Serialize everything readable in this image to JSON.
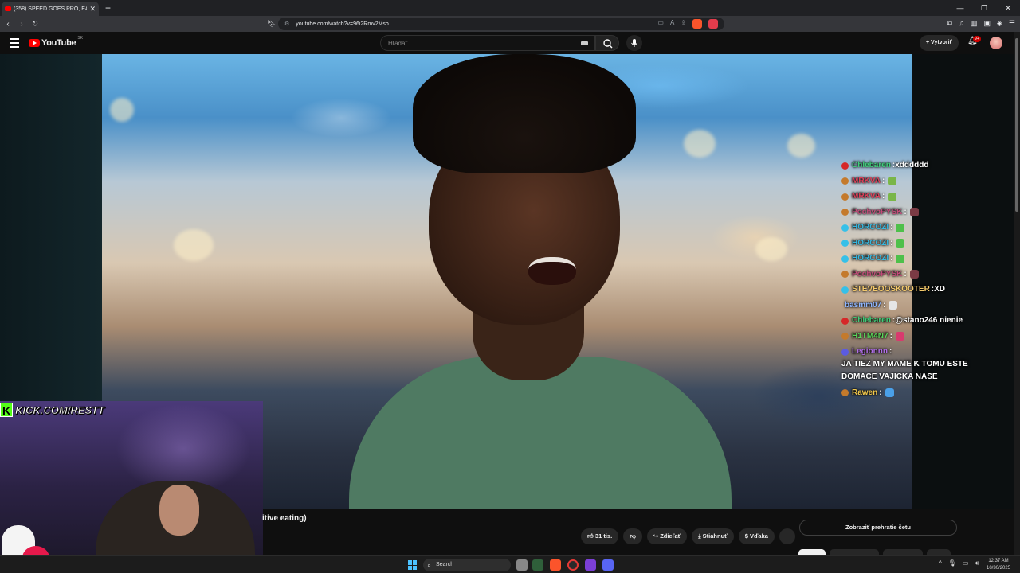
{
  "browser": {
    "tab_title": "(358) SPEED GOES PRO, EATS",
    "url": "youtube.com/watch?v=96i2Rmv2Mso",
    "notification_count": "1"
  },
  "youtube": {
    "logo_text": "YouTube",
    "country_code": "SK",
    "search_placeholder": "Hľadať",
    "create_label": "Vytvoriť",
    "notification_badge": "9+"
  },
  "overlay": {
    "kick_label": "KICK.COM/RESTT",
    "kick_letter": "K"
  },
  "chat": [
    {
      "user": "Chlebaren",
      "msg": "xdddddd",
      "color": "#3fd07a",
      "badge": "#d62828",
      "emote": null
    },
    {
      "user": "MRKVA",
      "msg": "",
      "color": "#e0405a",
      "badge": "#c47a2c",
      "emote": "#7ab648"
    },
    {
      "user": "MRKVA",
      "msg": "",
      "color": "#e0405a",
      "badge": "#c47a2c",
      "emote": "#7ab648"
    },
    {
      "user": "PochvoPYSK",
      "msg": "",
      "color": "#c34c7a",
      "badge": "#c47a2c",
      "emote": "#7a3a44"
    },
    {
      "user": "HORCOZI",
      "msg": "",
      "color": "#35b8e0",
      "badge": "#36c0e8",
      "emote": "#4ec04a"
    },
    {
      "user": "HORCOZI",
      "msg": "",
      "color": "#35b8e0",
      "badge": "#36c0e8",
      "emote": "#4ec04a"
    },
    {
      "user": "HORCOZI",
      "msg": "",
      "color": "#35b8e0",
      "badge": "#36c0e8",
      "emote": "#4ec04a"
    },
    {
      "user": "PochvoPYSK",
      "msg": "",
      "color": "#c34c7a",
      "badge": "#c47a2c",
      "emote": "#7a3a44"
    },
    {
      "user": "STEVEOOSKOOTER",
      "msg": "XD",
      "color": "#f3c96b",
      "badge": "#36c0e8",
      "emote": null
    },
    {
      "user": "basmm07",
      "msg": "",
      "color": "#8fb6ff",
      "badge": null,
      "emote": "#e6e6e6"
    },
    {
      "user": "Chlebaren",
      "msg": "@stano246 nienie",
      "color": "#3fd07a",
      "badge": "#d62828",
      "emote": null
    },
    {
      "user": "H1TM4N7",
      "msg": "",
      "color": "#5ad65a",
      "badge": "#c47a2c",
      "emote": "#d83a6e"
    },
    {
      "user": "Legionnn",
      "msg": "JA TIEZ MY MAME K TOMU ESTE DOMACE VAJICKA NASE",
      "color": "#b06ee8",
      "badge": "#5b5be0",
      "emote": null
    },
    {
      "user": "Rawen",
      "msg": "",
      "color": "#f2c84b",
      "badge": "#c47a2c",
      "emote": "#4aa0e8"
    }
  ],
  "video": {
    "title_fragment": "itive eating)"
  },
  "actions": {
    "like_count": "31 tis.",
    "share": "Zdieľať",
    "download": "Stiahnuť",
    "thanks": "Vďaka",
    "chat_replay": "Zobraziť prehratie četu"
  },
  "taskbar": {
    "search_label": "Search",
    "time": "12:37 AM",
    "date": "10/30/2025"
  }
}
